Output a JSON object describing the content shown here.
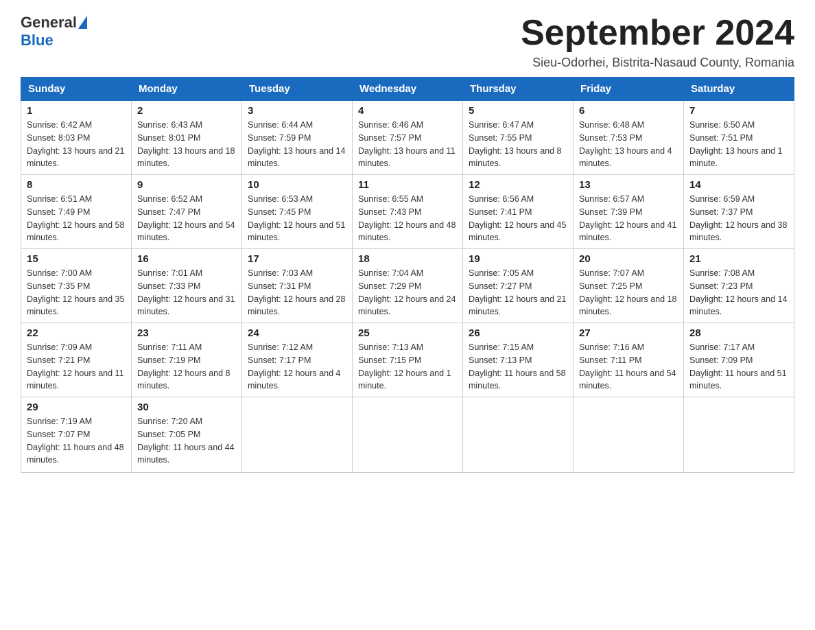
{
  "logo": {
    "general": "General",
    "blue": "Blue"
  },
  "title": "September 2024",
  "subtitle": "Sieu-Odorhei, Bistrita-Nasaud County, Romania",
  "days": [
    "Sunday",
    "Monday",
    "Tuesday",
    "Wednesday",
    "Thursday",
    "Friday",
    "Saturday"
  ],
  "weeks": [
    [
      {
        "num": "1",
        "sunrise": "6:42 AM",
        "sunset": "8:03 PM",
        "daylight": "13 hours and 21 minutes."
      },
      {
        "num": "2",
        "sunrise": "6:43 AM",
        "sunset": "8:01 PM",
        "daylight": "13 hours and 18 minutes."
      },
      {
        "num": "3",
        "sunrise": "6:44 AM",
        "sunset": "7:59 PM",
        "daylight": "13 hours and 14 minutes."
      },
      {
        "num": "4",
        "sunrise": "6:46 AM",
        "sunset": "7:57 PM",
        "daylight": "13 hours and 11 minutes."
      },
      {
        "num": "5",
        "sunrise": "6:47 AM",
        "sunset": "7:55 PM",
        "daylight": "13 hours and 8 minutes."
      },
      {
        "num": "6",
        "sunrise": "6:48 AM",
        "sunset": "7:53 PM",
        "daylight": "13 hours and 4 minutes."
      },
      {
        "num": "7",
        "sunrise": "6:50 AM",
        "sunset": "7:51 PM",
        "daylight": "13 hours and 1 minute."
      }
    ],
    [
      {
        "num": "8",
        "sunrise": "6:51 AM",
        "sunset": "7:49 PM",
        "daylight": "12 hours and 58 minutes."
      },
      {
        "num": "9",
        "sunrise": "6:52 AM",
        "sunset": "7:47 PM",
        "daylight": "12 hours and 54 minutes."
      },
      {
        "num": "10",
        "sunrise": "6:53 AM",
        "sunset": "7:45 PM",
        "daylight": "12 hours and 51 minutes."
      },
      {
        "num": "11",
        "sunrise": "6:55 AM",
        "sunset": "7:43 PM",
        "daylight": "12 hours and 48 minutes."
      },
      {
        "num": "12",
        "sunrise": "6:56 AM",
        "sunset": "7:41 PM",
        "daylight": "12 hours and 45 minutes."
      },
      {
        "num": "13",
        "sunrise": "6:57 AM",
        "sunset": "7:39 PM",
        "daylight": "12 hours and 41 minutes."
      },
      {
        "num": "14",
        "sunrise": "6:59 AM",
        "sunset": "7:37 PM",
        "daylight": "12 hours and 38 minutes."
      }
    ],
    [
      {
        "num": "15",
        "sunrise": "7:00 AM",
        "sunset": "7:35 PM",
        "daylight": "12 hours and 35 minutes."
      },
      {
        "num": "16",
        "sunrise": "7:01 AM",
        "sunset": "7:33 PM",
        "daylight": "12 hours and 31 minutes."
      },
      {
        "num": "17",
        "sunrise": "7:03 AM",
        "sunset": "7:31 PM",
        "daylight": "12 hours and 28 minutes."
      },
      {
        "num": "18",
        "sunrise": "7:04 AM",
        "sunset": "7:29 PM",
        "daylight": "12 hours and 24 minutes."
      },
      {
        "num": "19",
        "sunrise": "7:05 AM",
        "sunset": "7:27 PM",
        "daylight": "12 hours and 21 minutes."
      },
      {
        "num": "20",
        "sunrise": "7:07 AM",
        "sunset": "7:25 PM",
        "daylight": "12 hours and 18 minutes."
      },
      {
        "num": "21",
        "sunrise": "7:08 AM",
        "sunset": "7:23 PM",
        "daylight": "12 hours and 14 minutes."
      }
    ],
    [
      {
        "num": "22",
        "sunrise": "7:09 AM",
        "sunset": "7:21 PM",
        "daylight": "12 hours and 11 minutes."
      },
      {
        "num": "23",
        "sunrise": "7:11 AM",
        "sunset": "7:19 PM",
        "daylight": "12 hours and 8 minutes."
      },
      {
        "num": "24",
        "sunrise": "7:12 AM",
        "sunset": "7:17 PM",
        "daylight": "12 hours and 4 minutes."
      },
      {
        "num": "25",
        "sunrise": "7:13 AM",
        "sunset": "7:15 PM",
        "daylight": "12 hours and 1 minute."
      },
      {
        "num": "26",
        "sunrise": "7:15 AM",
        "sunset": "7:13 PM",
        "daylight": "11 hours and 58 minutes."
      },
      {
        "num": "27",
        "sunrise": "7:16 AM",
        "sunset": "7:11 PM",
        "daylight": "11 hours and 54 minutes."
      },
      {
        "num": "28",
        "sunrise": "7:17 AM",
        "sunset": "7:09 PM",
        "daylight": "11 hours and 51 minutes."
      }
    ],
    [
      {
        "num": "29",
        "sunrise": "7:19 AM",
        "sunset": "7:07 PM",
        "daylight": "11 hours and 48 minutes."
      },
      {
        "num": "30",
        "sunrise": "7:20 AM",
        "sunset": "7:05 PM",
        "daylight": "11 hours and 44 minutes."
      },
      null,
      null,
      null,
      null,
      null
    ]
  ]
}
